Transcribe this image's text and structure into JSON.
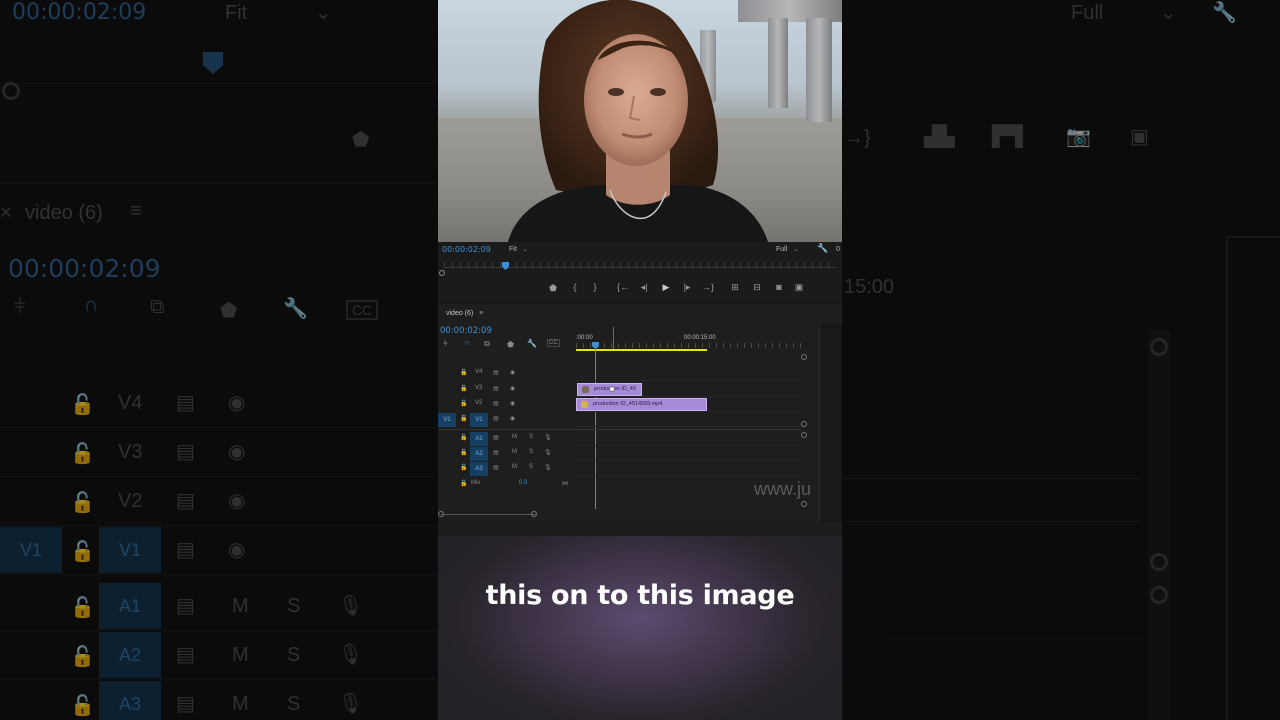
{
  "background": {
    "timecode_top": "00:00:02:09",
    "fit_label": "Fit",
    "full_label": "Full",
    "sequence_name": "video (6)",
    "timecode_big": "00:00:02:09",
    "ruler_label": "15:00",
    "tracks": [
      "V4",
      "V3",
      "V2",
      "V1",
      "A1",
      "A2",
      "A3"
    ],
    "v1_target": "V1",
    "m_label": "M",
    "s_label": "S",
    "watermark": "www.ju"
  },
  "monitor": {
    "timecode": "00:00:02:09",
    "fit_label": "Fit",
    "quality_label": "Full",
    "zero_label": "0",
    "transport": [
      "marker-icon",
      "in-point-icon",
      "out-point-icon",
      "go-to-in-icon",
      "step-back-icon",
      "play-icon",
      "step-forward-icon",
      "go-to-out-icon",
      "lift-icon",
      "extract-icon",
      "export-frame-icon",
      "button-editor-icon"
    ]
  },
  "timeline": {
    "title": "video (6)",
    "menu_icon": "hamburger-icon",
    "timecode": "00:00:02:09",
    "ruler_start": ":00:00",
    "ruler_mark": "00:00:15:00",
    "tracks": [
      {
        "name": "V4",
        "type": "video"
      },
      {
        "name": "V3",
        "type": "video"
      },
      {
        "name": "V2",
        "type": "video"
      },
      {
        "name": "V1",
        "type": "video",
        "target": "V1"
      },
      {
        "name": "A1",
        "type": "audio",
        "m": "M",
        "s": "S"
      },
      {
        "name": "A2",
        "type": "audio",
        "m": "M",
        "s": "S"
      },
      {
        "name": "A3",
        "type": "audio",
        "m": "M",
        "s": "S"
      }
    ],
    "mix_label": "Mix",
    "mix_value": "0.0",
    "clips": [
      {
        "track": "V3",
        "name": "production ID_45"
      },
      {
        "track": "V2",
        "name": "production ID_4514559.mp4"
      }
    ]
  },
  "caption": "this on to this image",
  "colors": {
    "timecode_blue": "#3d8fd6",
    "clip_purple": "#a58ad8",
    "work_area_yellow": "#e6e600",
    "target_blue": "#164063"
  }
}
